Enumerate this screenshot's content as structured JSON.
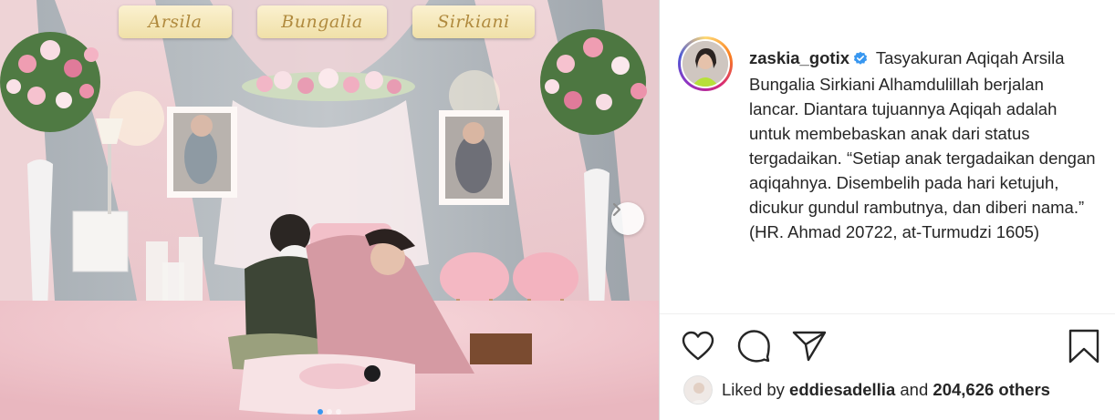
{
  "photo": {
    "banners": [
      "Arsila",
      "Bungalia",
      "Sirkiani"
    ],
    "next_icon": "chevron-right-icon",
    "carousel_total": 3,
    "carousel_active": 1
  },
  "post": {
    "username": "zaskia_gotix",
    "verified_icon": "verified-badge-icon",
    "caption": "Tasyakuran Aqiqah Arsila Bungalia Sirkiani Alhamdulillah berjalan lancar. Diantara tujuannya Aqiqah adalah untuk membebaskan anak dari status tergadaikan. “Setiap anak tergadaikan dengan aqiqahnya. Disembelih pada hari ketujuh, dicukur gundul rambutnya, dan diberi nama.” (HR. Ahmad 20722, at-Turmudzi 1605)"
  },
  "actions": {
    "like_icon": "heart-icon",
    "comment_icon": "comment-icon",
    "share_icon": "send-icon",
    "save_icon": "bookmark-icon"
  },
  "likes": {
    "prefix": "Liked by",
    "user": "eddiesadellia",
    "and": "and",
    "others": "204,626 others"
  },
  "colors": {
    "accent": "#3897f0",
    "text": "#262626",
    "border": "#dbdbdb"
  }
}
